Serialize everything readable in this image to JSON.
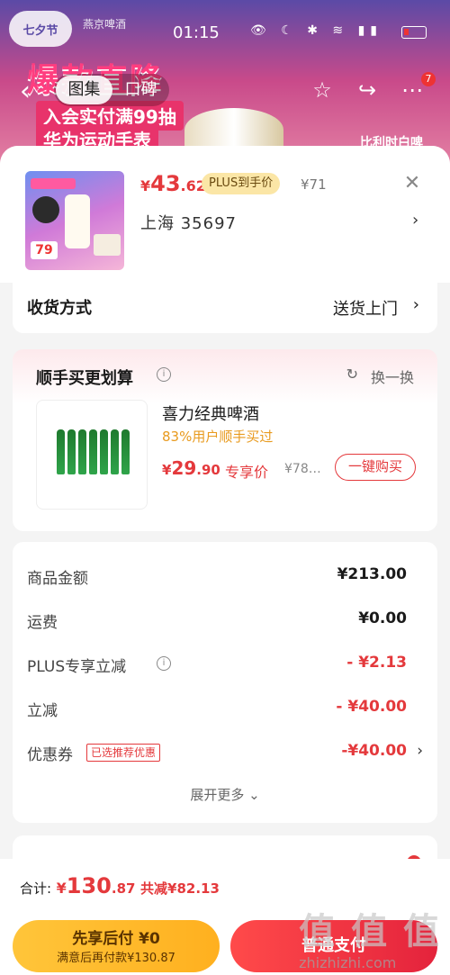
{
  "status_bar": {
    "time": "01:15",
    "brand": "燕京啤酒",
    "logo": "七夕节"
  },
  "background": {
    "banner_title": "爆款直降",
    "banner_line1": "入会实付满99抽",
    "banner_line2": "华为运动手表",
    "banner_right": "比利时白啤"
  },
  "nav": {
    "tabs": [
      {
        "label": "图集"
      },
      {
        "label": "口碑"
      }
    ],
    "badge": "7",
    "icons": [
      "back-icon",
      "star-icon",
      "share-icon",
      "more-icon"
    ]
  },
  "product": {
    "price_currency": "¥",
    "price_int": "43",
    "price_dec": ".62",
    "plus_tag": "PLUS到手价",
    "original_price": "¥71",
    "spec": "上海  35697",
    "thumb_badge": "79"
  },
  "delivery": {
    "label": "收货方式",
    "value": "送货上门"
  },
  "addon": {
    "title": "顺手买更划算",
    "refresh": "换一换",
    "item_name": "喜力经典啤酒",
    "item_sub": "83%用户顺手买过",
    "price_currency": "¥",
    "price_int": "29",
    "price_dec": ".90",
    "exclusive": "专享价",
    "original": "¥78…",
    "buy_button": "一键购买"
  },
  "summary": {
    "rows": [
      {
        "label": "商品金额",
        "value": "¥213.00"
      },
      {
        "label": "运费",
        "value": "¥0.00"
      },
      {
        "label": "PLUS专享立减",
        "value": "- ¥2.13"
      },
      {
        "label": "立减",
        "value": "- ¥40.00"
      },
      {
        "label": "优惠券",
        "tag": "已选推荐优惠",
        "value": "-¥40.00"
      }
    ],
    "expand": "展开更多"
  },
  "footer": {
    "total_label": "合计:",
    "total_currency": "¥",
    "total_int": "130",
    "total_dec": ".87",
    "saved": "共减¥82.13",
    "later_btn_main": "先享后付 ¥0",
    "later_btn_sub": "满意后再付款¥130.87",
    "pay_btn": "普通支付"
  },
  "watermark": {
    "big": "值 值 值",
    "small": "zhizhizhi.com"
  },
  "colors": {
    "accent": "#e4393c",
    "gold": "#ffb01f",
    "plus": "#fbe6a6"
  }
}
